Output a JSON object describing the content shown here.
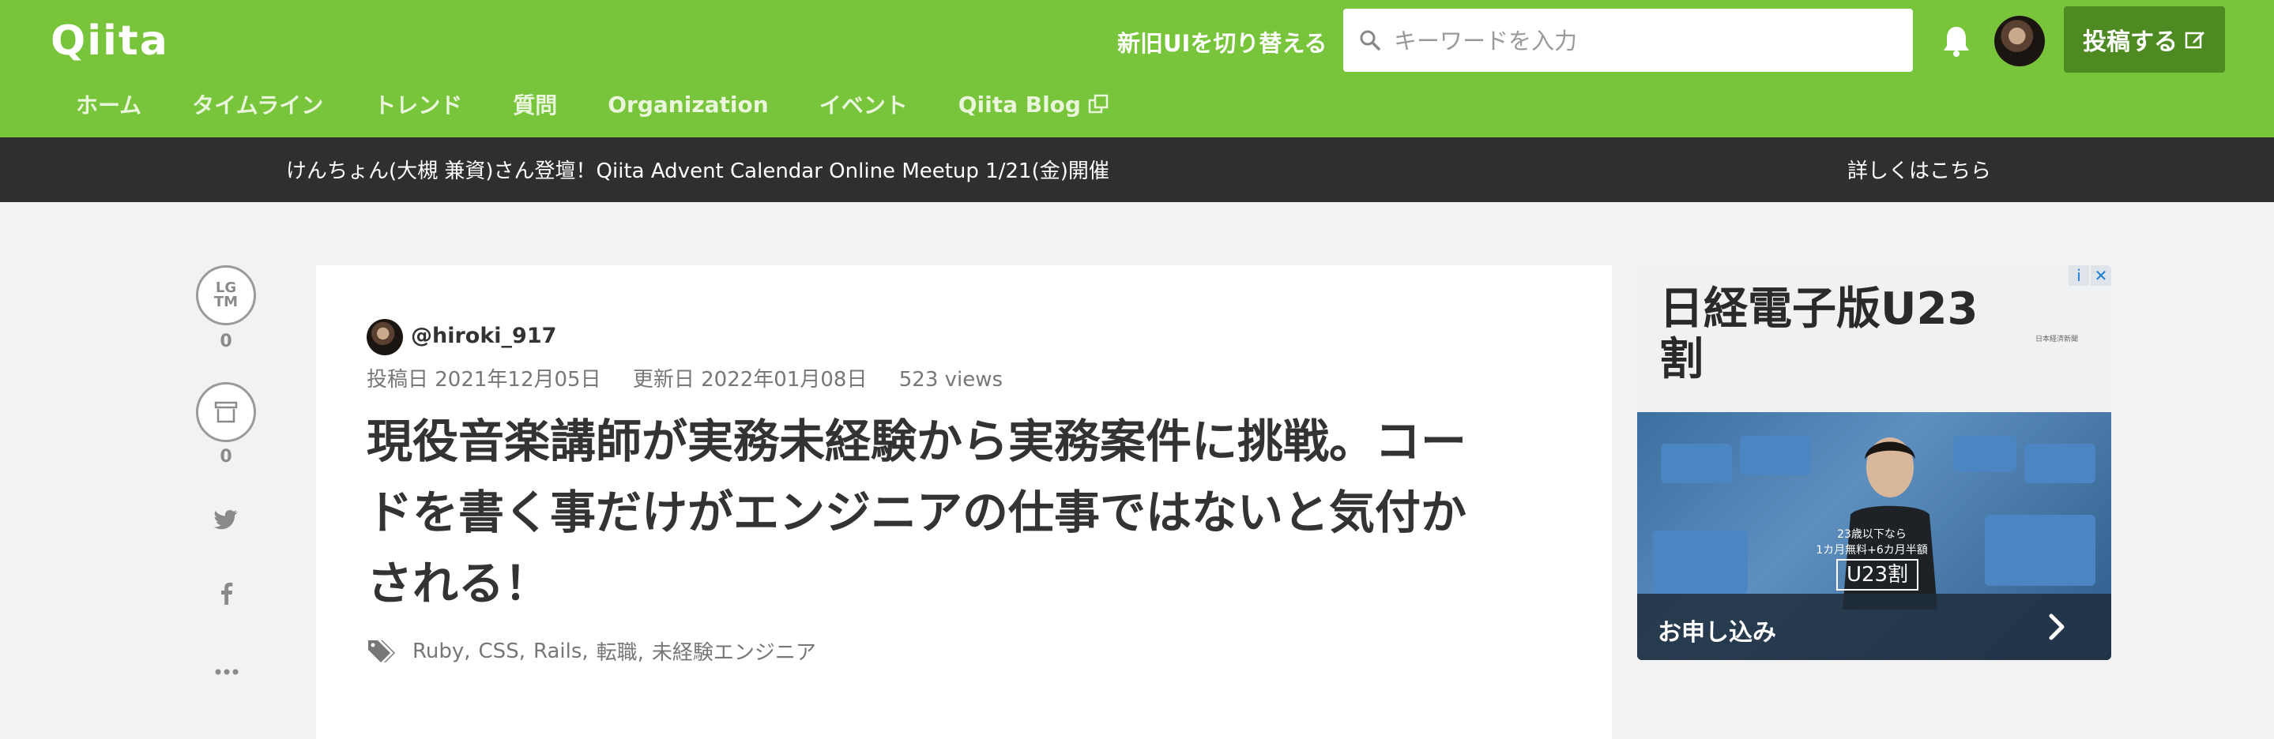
{
  "header": {
    "logo": "Qiita",
    "switch_ui_label": "新旧UIを切り替える",
    "search_placeholder": "キーワードを入力",
    "post_label": "投稿する"
  },
  "nav": {
    "items": [
      "ホーム",
      "タイムライン",
      "トレンド",
      "質問",
      "Organization",
      "イベント",
      "Qiita Blog"
    ]
  },
  "banner": {
    "text": "けんちょん(大槻 兼資)さん登壇！Qiita Advent Calendar Online Meetup 1/21(金)開催",
    "link": "詳しくはこちら"
  },
  "side": {
    "lgtm_label_1": "LG",
    "lgtm_label_2": "TM",
    "lgtm_count": "0",
    "stock_count": "0"
  },
  "article": {
    "author": "@hiroki_917",
    "posted": "投稿日 2021年12月05日",
    "updated": "更新日 2022年01月08日",
    "views": "523 views",
    "title": "現役音楽講師が実務未経験から実務案件に挑戦。コードを書く事だけがエンジニアの仕事ではないと気付かされる！",
    "tags": [
      "Ruby,",
      "CSS,",
      "Rails,",
      "転職,",
      "未経験エンジニア"
    ]
  },
  "ad": {
    "title": "日経電子版U23割",
    "small": "日本経済新聞",
    "promo_line1": "23歳以下なら",
    "promo_line2": "1カ月無料+6カ月半額",
    "badge": "U23割",
    "cta": "お申し込み",
    "info_icon": "i",
    "close_icon": "✕"
  },
  "colors": {
    "brand": "#78c43b",
    "post_button": "#4d8a21",
    "banner": "#2f2f2f"
  }
}
